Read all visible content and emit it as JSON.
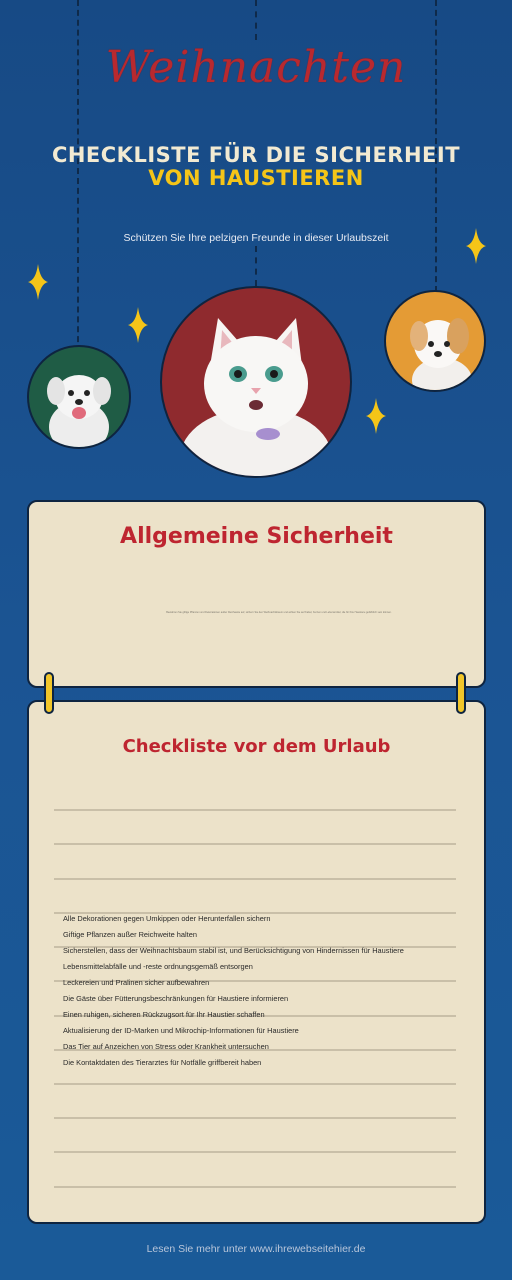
{
  "header": {
    "script_title": "Weihnachten",
    "title_line1": "CHECKLISTE FÜR DIE SICHERHEIT",
    "title_line2": "VON HAUSTIEREN",
    "subtitle": "Schützen Sie Ihre pelzigen Freunde in dieser Urlaubszeit"
  },
  "colors": {
    "background": "#1b5493",
    "accent_red": "#be2530",
    "accent_yellow": "#f5c518",
    "card": "#ece2c9"
  },
  "pets": [
    {
      "name": "puppy-green-circle",
      "bg": "#1f5c45"
    },
    {
      "name": "white-cat-red-circle",
      "bg": "#8f2a2e"
    },
    {
      "name": "puppy-orange-circle",
      "bg": "#e49b35"
    }
  ],
  "section_general": {
    "title": "Allgemeine Sicherheit",
    "body": "Bewahren Sie giftige Pflanzen und Dekorationen außer Reichweite auf, sichern Sie den Weihnachtsbaum und achten Sie auf Kabel, Kerzen und Lebensmittel, die für Ihre Haustiere gefährlich sein können."
  },
  "section_checklist": {
    "title": "Checkliste vor dem Urlaub",
    "items": [
      "Alle Dekorationen gegen Umkippen oder Herunterfallen sichern",
      "Giftige Pflanzen außer Reichweite halten",
      "Sicherstellen, dass der Weihnachtsbaum stabil ist, und Berücksichtigung von Hindernissen für Haustiere",
      "Lebensmittelabfälle und -reste ordnungsgemäß entsorgen",
      "Leckereien und Pralinen sicher aufbewahren",
      "Die Gäste über Fütterungsbeschränkungen für Haustiere informieren",
      "Einen ruhigen, sicheren Rückzugsort für Ihr Haustier schaffen",
      "Aktualisierung der ID-Marken und Mikrochip-Informationen für Haustiere",
      "Das Tier auf Anzeichen von Stress oder Krankheit untersuchen",
      "Die Kontaktdaten des Tierarztes für Notfälle griffbereit haben"
    ]
  },
  "footer": {
    "text": "Lesen Sie mehr unter www.ihrewebseitehier.de"
  }
}
